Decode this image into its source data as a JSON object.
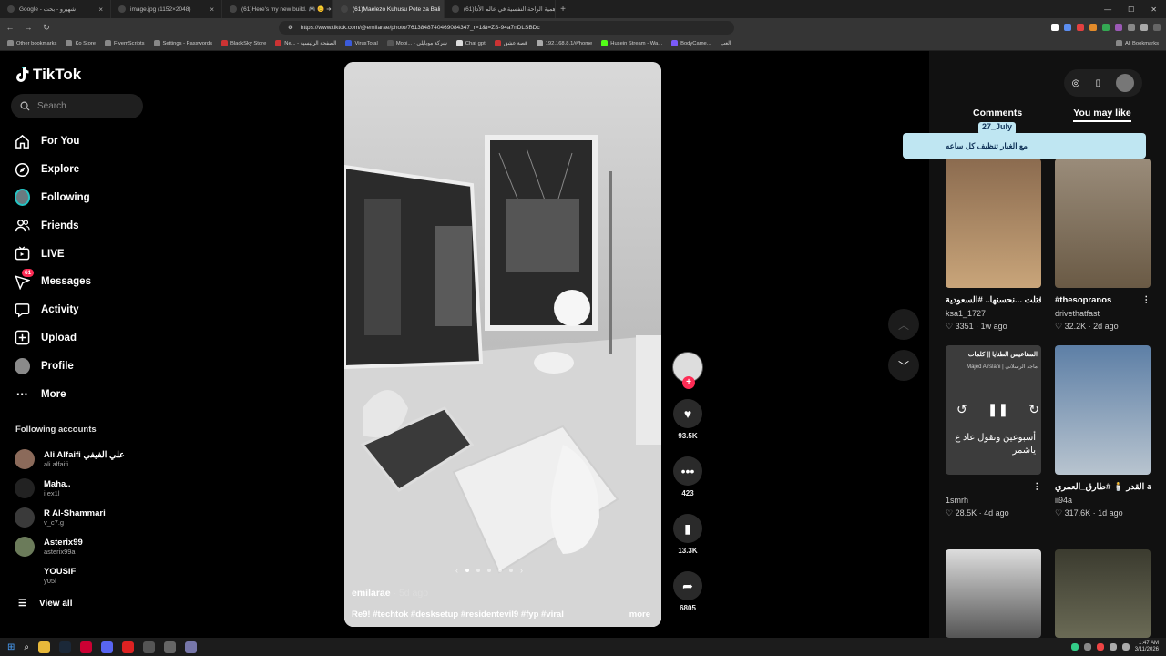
{
  "browser": {
    "tabs": [
      {
        "title": "Google - شهيرو - بحث",
        "active": false
      },
      {
        "title": "image.jpg (1152×2048)",
        "active": false
      },
      {
        "title": "(61)Here's my new build. 🎮 😊 ➔ St",
        "active": false
      },
      {
        "title": "(61)Maelezo Kuhusu Pete za Bali",
        "active": false
      },
      {
        "title": "(61)أهمية الراحة النفسية في عالم الأدا",
        "active": true
      }
    ],
    "url": "https://www.tiktok.com/@emilarae/photo/7613848740469084347_r=1&t=ZS-94a7nDLSBDc",
    "bookmarks": [
      "Other bookmarks",
      "Ko Store",
      "FivemScripts",
      "Settings - Passwords",
      "BlackSky Store",
      "Ne... - الصفحة الرئيسية",
      "VirusTotal",
      "Mobi... - شركة موبايلي",
      "Chat gpt",
      "قصة عشق",
      "192.168.8.1/#/home",
      "Husein Stream - Wa...",
      "BodyCame...",
      "العب"
    ],
    "all_bookmarks": "All Bookmarks"
  },
  "tiktok": {
    "logo": "TikTok",
    "search_placeholder": "Search",
    "nav": [
      {
        "label": "For You",
        "icon": "home-icon"
      },
      {
        "label": "Explore",
        "icon": "compass-icon"
      },
      {
        "label": "Following",
        "icon": "following-avatar-icon"
      },
      {
        "label": "Friends",
        "icon": "friends-icon"
      },
      {
        "label": "LIVE",
        "icon": "live-icon"
      },
      {
        "label": "Messages",
        "icon": "messages-icon",
        "badge": "61"
      },
      {
        "label": "Activity",
        "icon": "activity-icon"
      },
      {
        "label": "Upload",
        "icon": "upload-icon"
      },
      {
        "label": "Profile",
        "icon": "profile-avatar-icon"
      },
      {
        "label": "More",
        "icon": "more-icon"
      }
    ],
    "following_title": "Following accounts",
    "accounts": [
      {
        "name": "Ali Alfaifi علي الفيفي",
        "handle": "ali.alfaifi"
      },
      {
        "name": "Maha..",
        "handle": "i.ex1l"
      },
      {
        "name": "R Al-Shammari",
        "handle": "v_c7.g"
      },
      {
        "name": "Asterix99",
        "handle": "asterix99a"
      },
      {
        "name": "YOUSIF",
        "handle": "y05i"
      }
    ],
    "view_all": "View all"
  },
  "video": {
    "author": "emilarae",
    "time": " · 5d ago",
    "caption": "Re9! #techtok #desksetup #residentevil9 #fyp #viral",
    "more": "more",
    "slides": 5,
    "current_slide": 1,
    "likes": "93.5K",
    "comments": "423",
    "saves": "13.3K",
    "shares": "6805"
  },
  "right": {
    "tabs": [
      "Comments",
      "You may like"
    ],
    "selected_tab": "You may like",
    "overlay_user": "27_July",
    "overlay_msg": "مع الغبار تنظيف كل ساعه",
    "cards": [
      {
        "title": "عنها الشوارب إلى فتلت ...نحسنها.. #السعودية",
        "author": "ksa1_1727",
        "likes": "3351",
        "age": "1w ago"
      },
      {
        "title": "#thesopranos",
        "author": "drivethatfast",
        "likes": "32.2K",
        "age": "2d ago"
      },
      {
        "title": "",
        "author": "1smrh",
        "likes": "28.5K",
        "age": "4d ago",
        "thumb_text": "السناعيس الطنايا || كلمات",
        "thumb_sub": "Majed Alrslani | ماجد الرسلاني",
        "thumb_body": "أسبوعين ونقول عاد ع ياشمر"
      },
      {
        "title": "دعاء ليلة القدر 🕯️ #طارق_العمري",
        "author": "ii94a",
        "likes": "317.6K",
        "age": "1d ago"
      }
    ]
  },
  "taskbar": {
    "time": "1:47 AM",
    "date": "3/11/2026"
  }
}
